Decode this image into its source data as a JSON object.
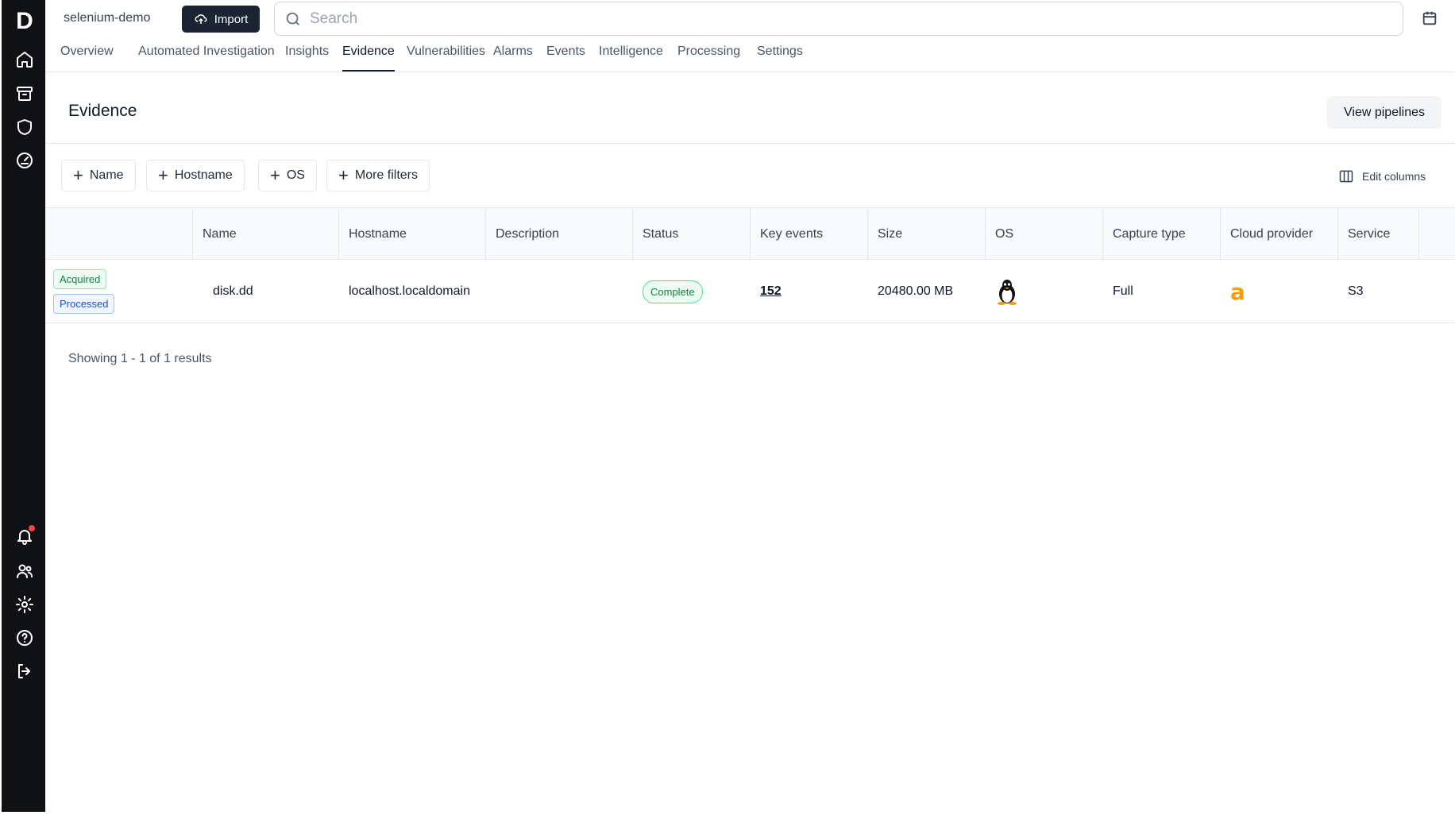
{
  "sidebar": {
    "logo": "D",
    "icons": [
      "home-icon",
      "archive-icon",
      "shield-icon",
      "gauge-icon",
      "bell-icon",
      "users-icon",
      "gear-icon",
      "help-icon",
      "logout-icon"
    ]
  },
  "topbar": {
    "project": "selenium-demo",
    "import_label": "Import",
    "search_placeholder": "Search"
  },
  "tabs": [
    "Overview",
    "Automated Investigation",
    "Insights",
    "Evidence",
    "Vulnerabilities",
    "Alarms",
    "Events",
    "Intelligence",
    "Processing",
    "Settings"
  ],
  "active_tab": "Evidence",
  "page": {
    "title": "Evidence",
    "view_pipelines_label": "View pipelines",
    "edit_columns_label": "Edit columns"
  },
  "filters": [
    "Name",
    "Hostname",
    "OS",
    "More filters"
  ],
  "table": {
    "columns": [
      "Name",
      "Hostname",
      "Description",
      "Status",
      "Key events",
      "Size",
      "OS",
      "Capture type",
      "Cloud provider",
      "Service"
    ],
    "rows": [
      {
        "tags": [
          "Acquired",
          "Processed"
        ],
        "name": "disk.dd",
        "hostname": "localhost.localdomain",
        "description": "",
        "status": "Complete",
        "key_events": "152",
        "size": "20480.00 MB",
        "os": "linux-tux-icon",
        "capture_type": "Full",
        "cloud_provider": "amazon-icon",
        "service": "S3"
      }
    ]
  },
  "results": "Showing 1 - 1 of 1 results",
  "colors": {
    "sidebar_bg": "#0f1114",
    "import_bg": "#1a2433",
    "acquired": "#15803d",
    "processed": "#1d4ed8",
    "notification_dot": "#ef4444"
  }
}
